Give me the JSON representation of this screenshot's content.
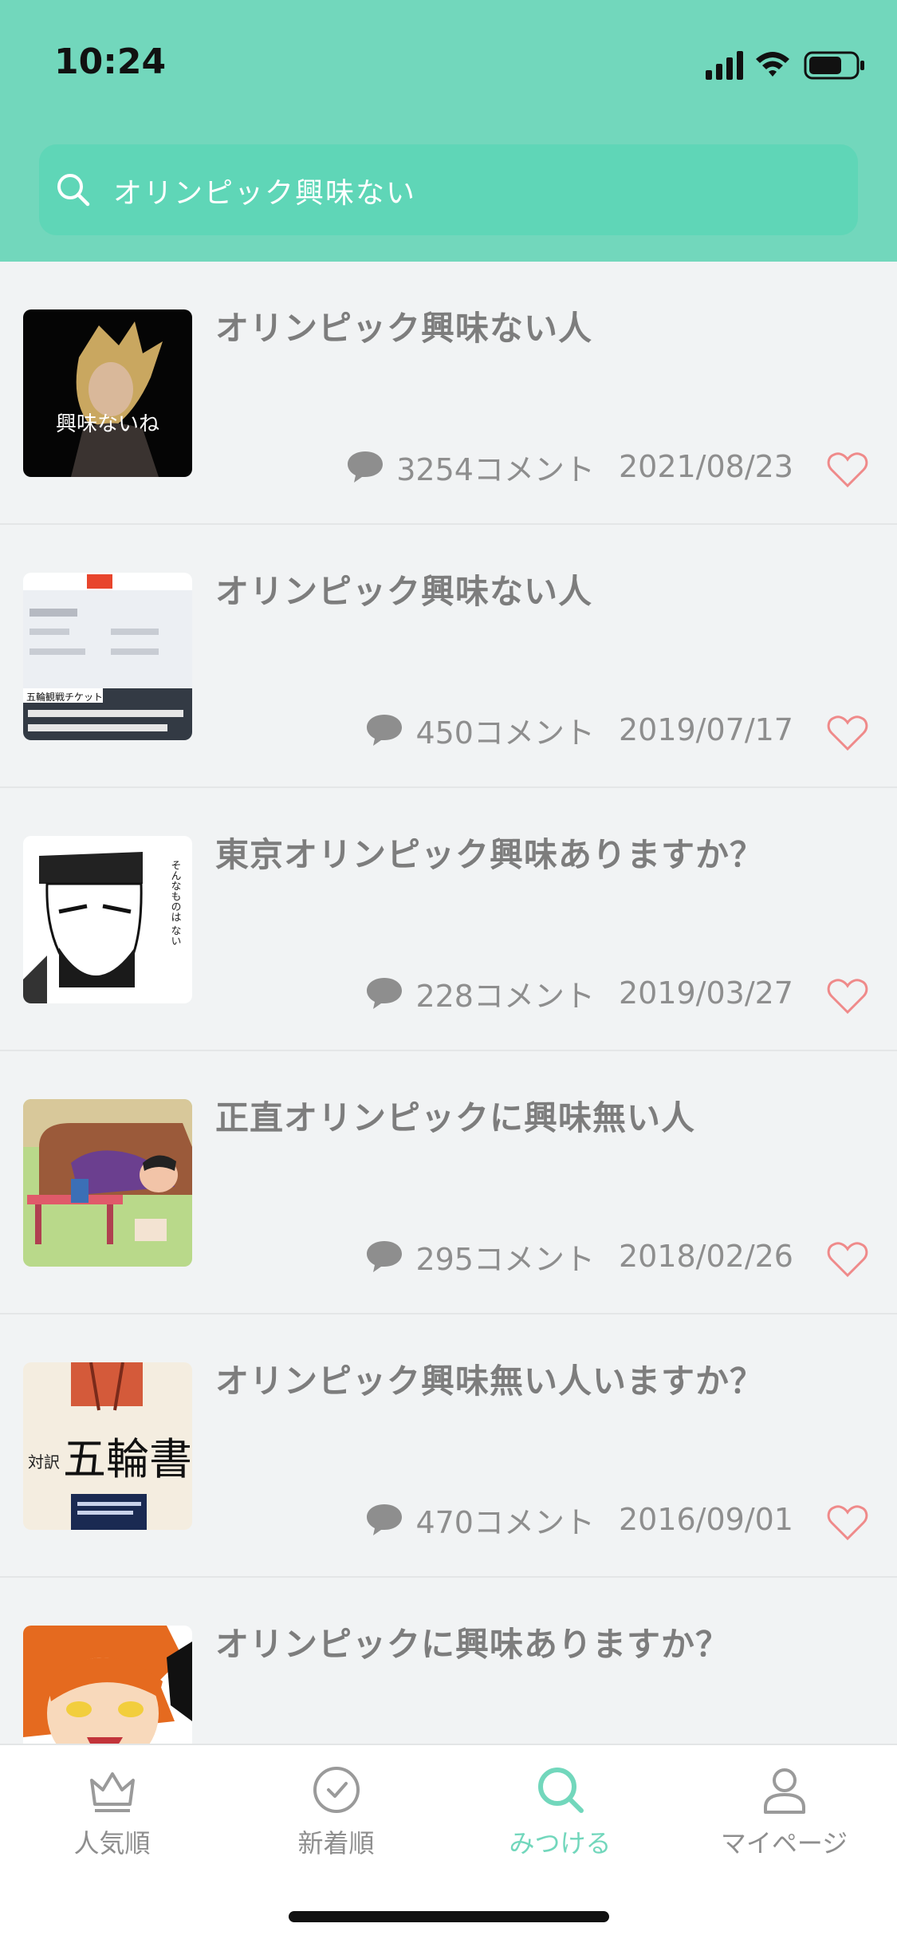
{
  "status_bar": {
    "time": "10:24"
  },
  "search": {
    "query": "オリンピック興味ない"
  },
  "results": [
    {
      "title": "オリンピック興味ない人",
      "comments": "3254コメント",
      "date": "2021/08/23",
      "thumb_caption": "興味ないね"
    },
    {
      "title": "オリンピック興味ない人",
      "comments": "450コメント",
      "date": "2019/07/17",
      "thumb_caption": "五輪観戦チケット"
    },
    {
      "title": "東京オリンピック興味ありますか？",
      "comments": "228コメント",
      "date": "2019/03/27",
      "thumb_caption": "そんなものは ない"
    },
    {
      "title": "正直オリンピックに興味無い人",
      "comments": "295コメント",
      "date": "2018/02/26",
      "thumb_caption": ""
    },
    {
      "title": "オリンピック興味無い人いますか？",
      "comments": "470コメント",
      "date": "2016/09/01",
      "thumb_caption": "五輪書"
    },
    {
      "title": "オリンピックに興味ありますか？",
      "comments": "",
      "date": "",
      "thumb_caption": ""
    }
  ],
  "tabs": [
    {
      "label": "人気順",
      "icon": "crown-icon"
    },
    {
      "label": "新着順",
      "icon": "clock-icon"
    },
    {
      "label": "みつける",
      "icon": "search-icon"
    },
    {
      "label": "マイページ",
      "icon": "person-icon"
    }
  ],
  "colors": {
    "header": "#72d7bc",
    "search_bg": "#5fd6b7",
    "active_tab": "#72d7bc",
    "heart": "#ef8a8a"
  }
}
